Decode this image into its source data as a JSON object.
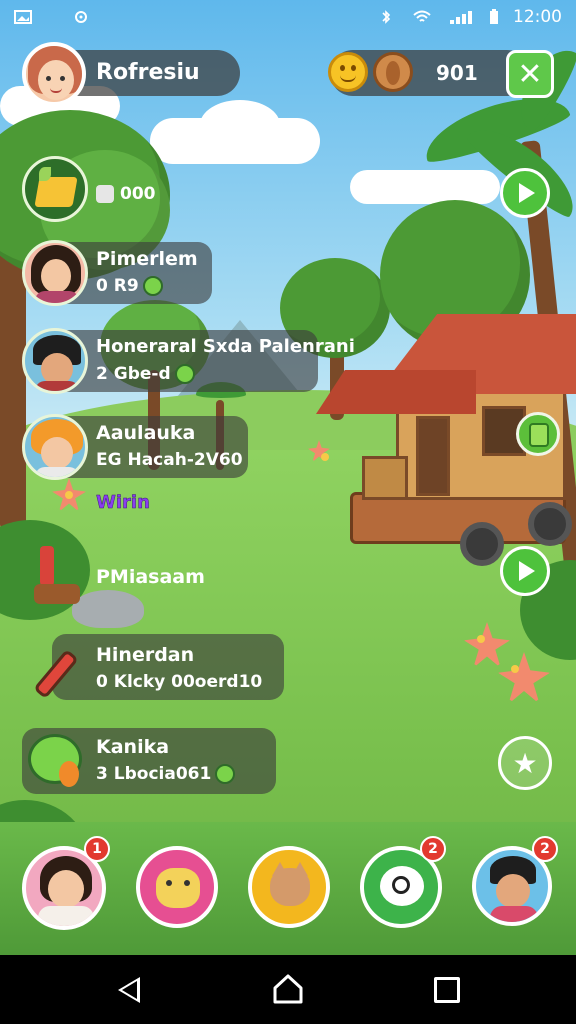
{
  "status_bar": {
    "time": "12:00"
  },
  "hud": {
    "player_name": "Rofresiu",
    "currency_value": "901",
    "close_label": "✕"
  },
  "rows": [
    {
      "title": "",
      "subtitle": "000"
    },
    {
      "title": "Pimerlem",
      "subtitle": "R9"
    },
    {
      "title": "Honeraral Sxda Palenrani",
      "subtitle": "Gbe-d"
    },
    {
      "title": "Aaulauka",
      "subtitle": "EG  Hacah-2V60"
    },
    {
      "title": "PMiasaam",
      "subtitle": ""
    },
    {
      "title": "Hinerdan",
      "subtitle": "Klcky 00oerd10"
    },
    {
      "title": "Kanika",
      "subtitle": "Lbocia061"
    }
  ],
  "row_counts": [
    "",
    "0",
    "2",
    "",
    "",
    "0",
    "3"
  ],
  "win_label": "Wirin",
  "dock": {
    "badges": [
      "1",
      "2",
      "2"
    ]
  },
  "colors": {
    "accent_green": "#4ec23c",
    "badge_red": "#e2392f",
    "win_purple": "#8a3df0"
  },
  "icons": {
    "hud": [
      "player-avatar-icon",
      "smiley-coin-icon",
      "seed-coin-icon",
      "close-icon"
    ],
    "rows": [
      "cheese-icon",
      "woman-avatar-icon",
      "man-avatar-icon",
      "boy-avatar-icon",
      "potion-icon",
      "brush-icon",
      "green-blob-icon"
    ],
    "dock": [
      "girl-avatar-icon",
      "pink-creature-icon",
      "cat-icon",
      "chat-icon",
      "man-avatar-icon"
    ]
  }
}
